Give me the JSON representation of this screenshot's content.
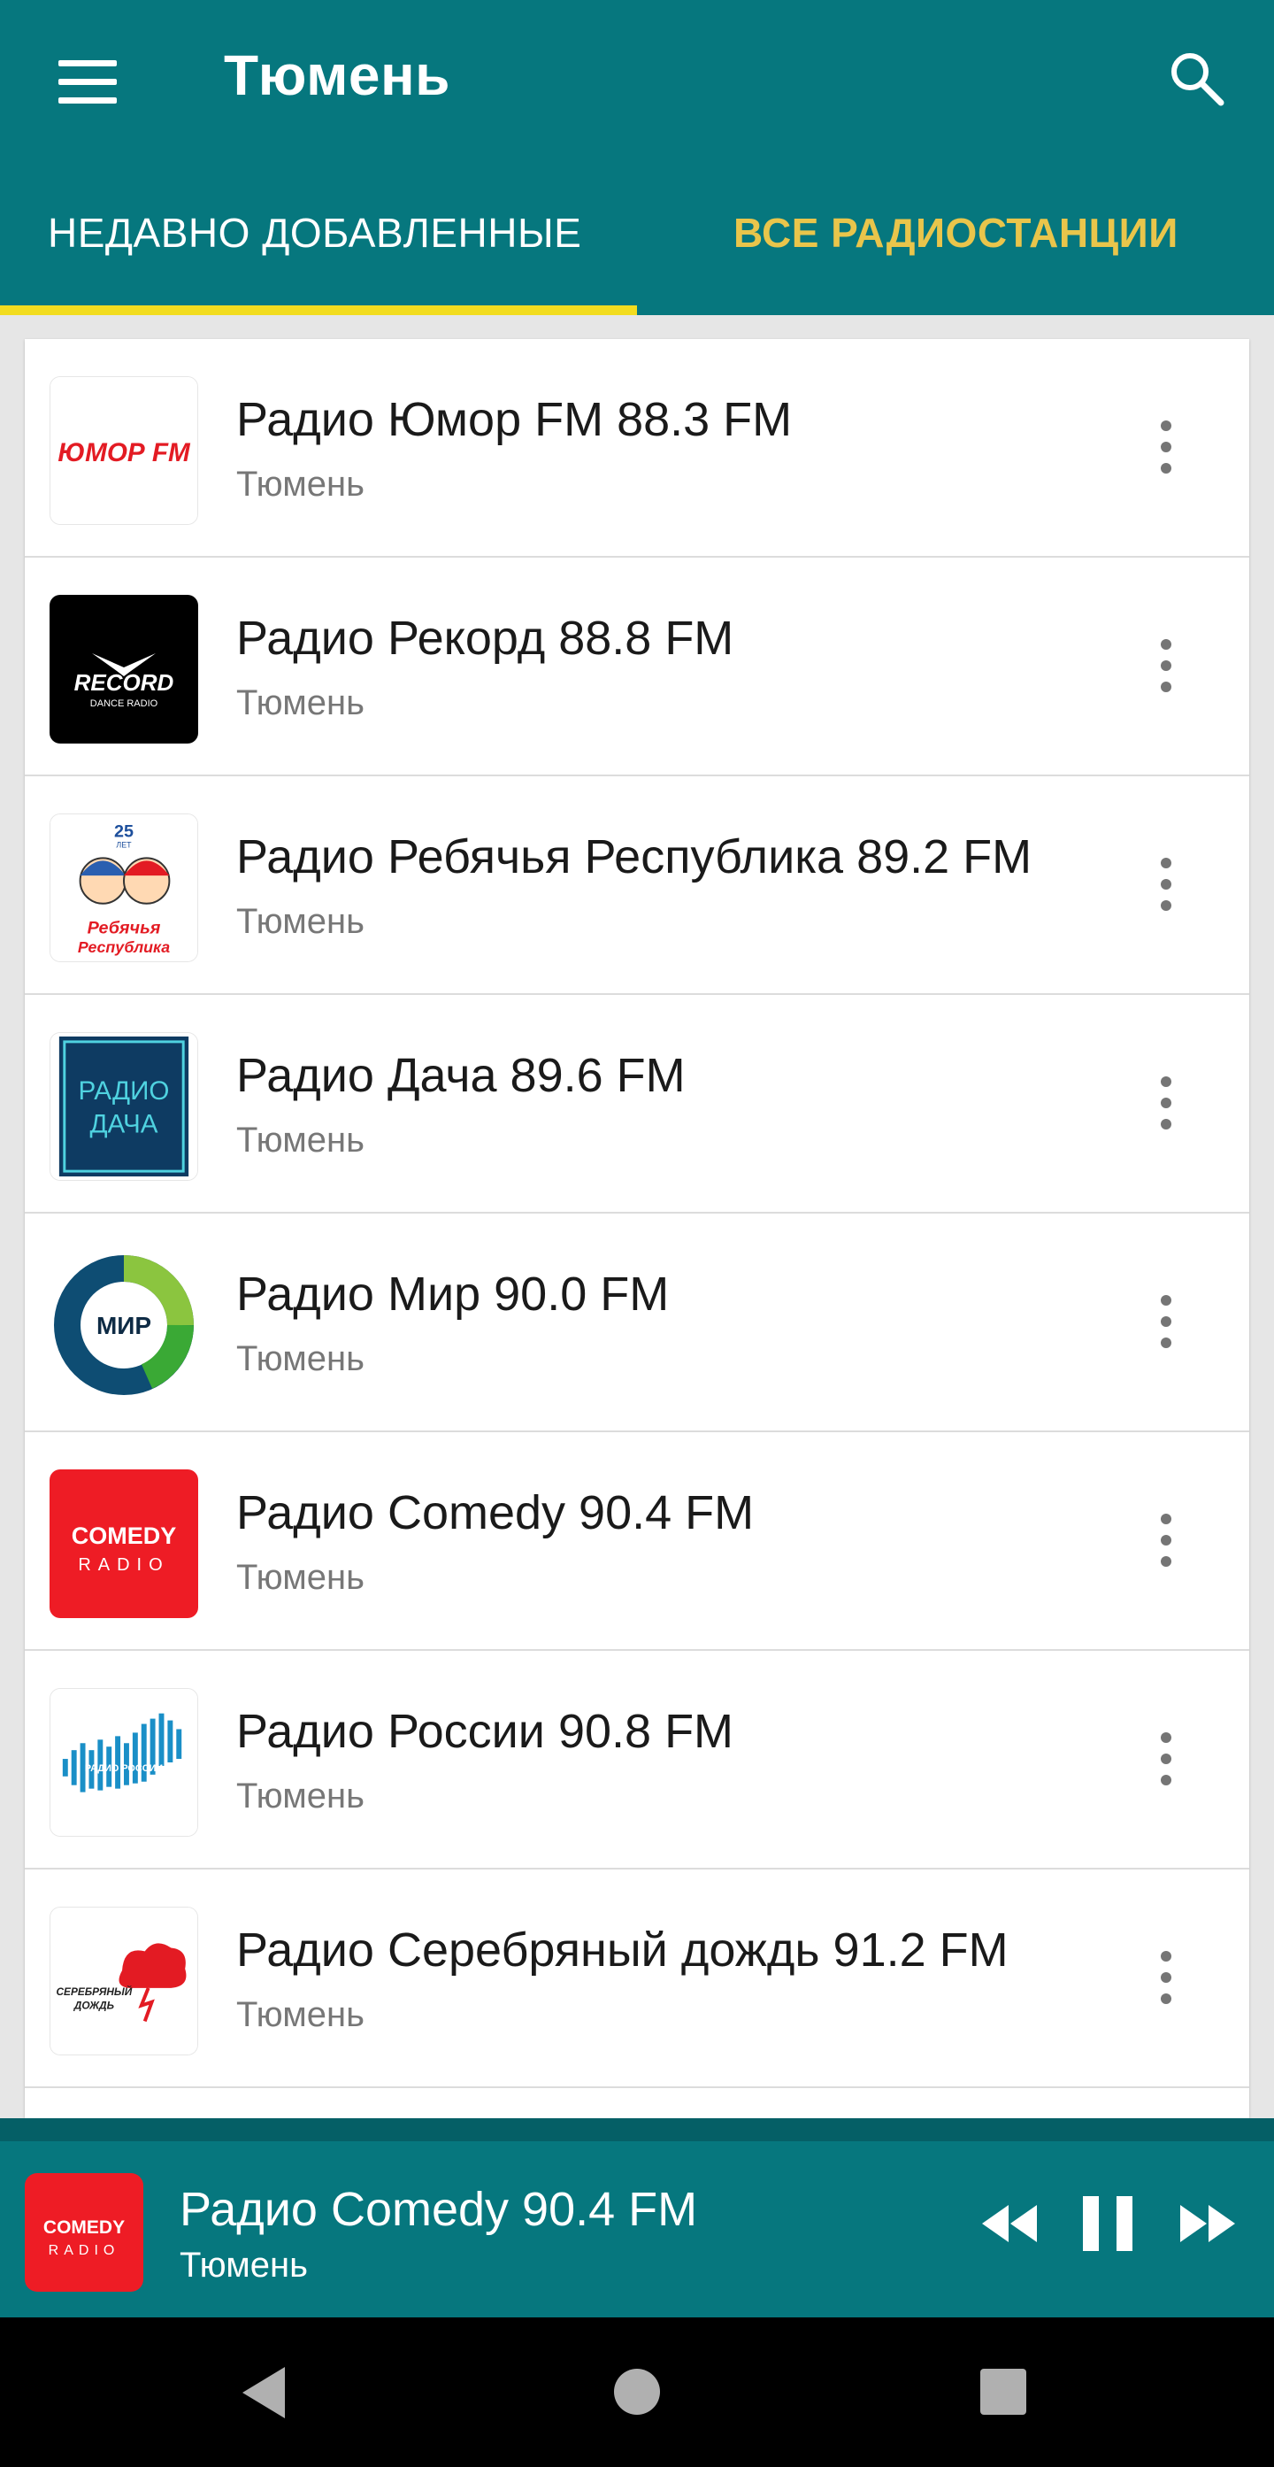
{
  "app": {
    "title": "Тюмень",
    "menu_icon": "hamburger-menu-icon",
    "search_icon": "search-icon"
  },
  "tabs": [
    {
      "label": "НЕДАВНО ДОБАВЛЕННЫЕ",
      "selected": true
    },
    {
      "label": "ВСЕ РАДИОСТАНЦИИ",
      "selected": false
    }
  ],
  "colors": {
    "primary": "#06777e",
    "tab_indicator": "#f2dc1f",
    "tab_inactive": "#e9c54b"
  },
  "stations": [
    {
      "name": "Радио Юмор FM 88.3 FM",
      "city": "Тюмень",
      "logo": "humor-fm-logo"
    },
    {
      "name": "Радио Рекорд 88.8 FM",
      "city": "Тюмень",
      "logo": "record-logo"
    },
    {
      "name": "Радио Ребячья Республика 89.2 FM",
      "city": "Тюмень",
      "logo": "rebyachya-respublika-logo"
    },
    {
      "name": "Радио Дача 89.6 FM",
      "city": "Тюмень",
      "logo": "radio-dacha-logo"
    },
    {
      "name": "Радио Мир 90.0 FM",
      "city": "Тюмень",
      "logo": "radio-mir-logo"
    },
    {
      "name": "Радио Comedy 90.4 FM",
      "city": "Тюмень",
      "logo": "comedy-radio-logo"
    },
    {
      "name": "Радио России 90.8 FM",
      "city": "Тюмень",
      "logo": "radio-rossii-logo"
    },
    {
      "name": "Радио Серебряный дождь 91.2 FM",
      "city": "Тюмень",
      "logo": "serebryany-dozhd-logo"
    }
  ],
  "logo_text": {
    "humor": "ЮМОР FM",
    "record": "RECORD",
    "record_sub": "DANCE RADIO",
    "rebyachya_years": "25",
    "rebyachya_years_sub": "ЛЕТ",
    "rebyachya_line1": "Ребячья",
    "rebyachya_line2": "Республика",
    "dacha_line1": "РАДИО",
    "dacha_line2": "ДАЧА",
    "mir": "МИР",
    "comedy_line1": "COMEDY",
    "comedy_line2": "RADIO",
    "rossii": "РАДИО РОССИИ",
    "serebryany_line1": "СЕРЕБРЯНЫЙ",
    "serebryany_line2": "ДОЖДЬ"
  },
  "player": {
    "title": "Радио Comedy 90.4 FM",
    "city": "Тюмень",
    "state": "playing"
  }
}
